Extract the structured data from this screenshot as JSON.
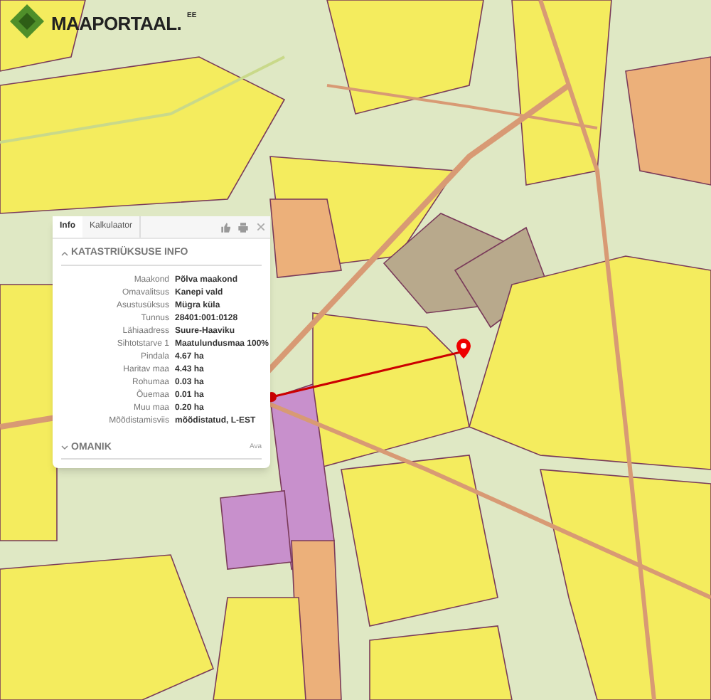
{
  "logo": {
    "name": "MAAPORTAAL.",
    "suffix": "EE"
  },
  "popup": {
    "tabs": [
      {
        "label": "Info",
        "selected": true
      },
      {
        "label": "Kalkulaator",
        "selected": false
      }
    ],
    "sections": [
      {
        "title": "KATASTRIÜKSUSE INFO",
        "expanded": true,
        "rows": [
          {
            "label": "Maakond",
            "value": "Põlva maakond"
          },
          {
            "label": "Omavalitsus",
            "value": "Kanepi vald"
          },
          {
            "label": "Asustusüksus",
            "value": "Mügra küla"
          },
          {
            "label": "Tunnus",
            "value": "28401:001:0128"
          },
          {
            "label": "Lähiaadress",
            "value": "Suure-Haaviku"
          },
          {
            "label": "Sihtotstarve 1",
            "value": "Maatulundusmaa 100%"
          },
          {
            "label": "Pindala",
            "value": "4.67 ha"
          },
          {
            "label": "Haritav maa",
            "value": "4.43 ha"
          },
          {
            "label": "Rohumaa",
            "value": "0.03 ha"
          },
          {
            "label": "Õuemaa",
            "value": "0.01 ha"
          },
          {
            "label": "Muu maa",
            "value": "0.20 ha"
          },
          {
            "label": "Mõõdistamisviis",
            "value": "mõõdistatud, L-EST"
          }
        ]
      },
      {
        "title": "OMANIK",
        "expanded": false,
        "action": "Ava"
      }
    ]
  }
}
